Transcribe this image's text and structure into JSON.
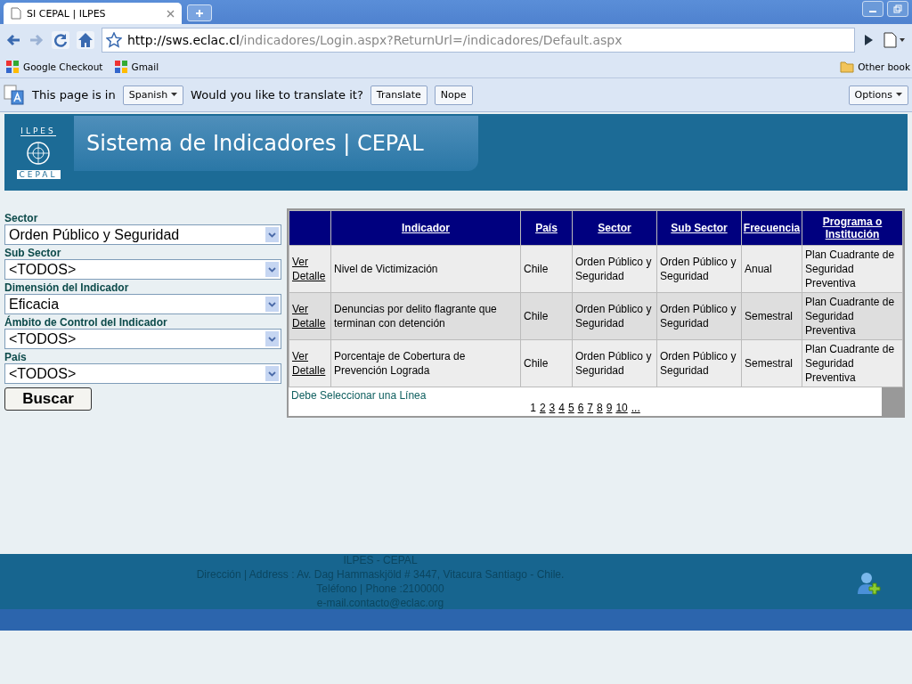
{
  "browser": {
    "tab_title": "SI CEPAL | ILPES",
    "url_host": "http://sws.eclac.cl",
    "url_path": "/indicadores/Login.aspx?ReturnUrl=/indicadores/Default.aspx",
    "bookmarks": [
      "Google Checkout",
      "Gmail"
    ],
    "other_bookmarks": "Other book",
    "translate_bar": {
      "prefix": "This page is in",
      "language": "Spanish",
      "question": "Would you like to translate it?",
      "buttons": [
        "Translate",
        "Nope"
      ],
      "options": "Options"
    }
  },
  "banner": {
    "title": "Sistema de Indicadores | CEPAL",
    "logo_top": "ILPES",
    "logo_bottom": "CEPAL"
  },
  "filters": [
    {
      "label": "Sector",
      "value": "Orden Público y Seguridad"
    },
    {
      "label": "Sub Sector",
      "value": "<TODOS>"
    },
    {
      "label": "Dimensión del Indicador",
      "value": "Eficacia"
    },
    {
      "label": "Ámbito de Control del Indicador",
      "value": "<TODOS>"
    },
    {
      "label": "País",
      "value": "<TODOS>"
    }
  ],
  "search_button": "Buscar",
  "table": {
    "columns": [
      "Indicador",
      "País",
      "Sector",
      "Sub Sector",
      "Frecuencia",
      "Programa o Institución"
    ],
    "rows": [
      {
        "link": "Ver Detalle",
        "cells": [
          "Nivel de Victimización",
          "Chile",
          "Orden Público y Seguridad",
          "Orden Público y Seguridad",
          "Anual",
          "Plan Cuadrante de Seguridad Preventiva"
        ]
      },
      {
        "link": "Ver Detalle",
        "cells": [
          "Denuncias por delito flagrante que terminan con detención",
          "Chile",
          "Orden Público y Seguridad",
          "Orden Público y Seguridad",
          "Semestral",
          "Plan Cuadrante de Seguridad Preventiva"
        ]
      },
      {
        "link": "Ver Detalle",
        "cells": [
          "Porcentaje de Cobertura de Prevención Lograda",
          "Chile",
          "Orden Público y Seguridad",
          "Orden Público y Seguridad",
          "Semestral",
          "Plan Cuadrante de Seguridad Preventiva"
        ]
      }
    ],
    "message": "Debe Seleccionar una Línea",
    "pages": [
      {
        "label": "1",
        "selected": true
      },
      {
        "label": "2",
        "selected": false
      },
      {
        "label": "3",
        "selected": false
      },
      {
        "label": "4",
        "selected": false
      },
      {
        "label": "5",
        "selected": false
      },
      {
        "label": "6",
        "selected": false
      },
      {
        "label": "7",
        "selected": false
      },
      {
        "label": "8",
        "selected": false
      },
      {
        "label": "9",
        "selected": false
      },
      {
        "label": "10",
        "selected": false
      },
      {
        "label": "...",
        "selected": false
      }
    ]
  },
  "footer": [
    "ILPES - CEPAL",
    "Dirección | Address : Av. Dag Hammaskjöld # 3447, Vitacura Santiago - Chile.",
    "Teléfono | Phone :2100000",
    "e-mail.contacto@eclac.org"
  ]
}
